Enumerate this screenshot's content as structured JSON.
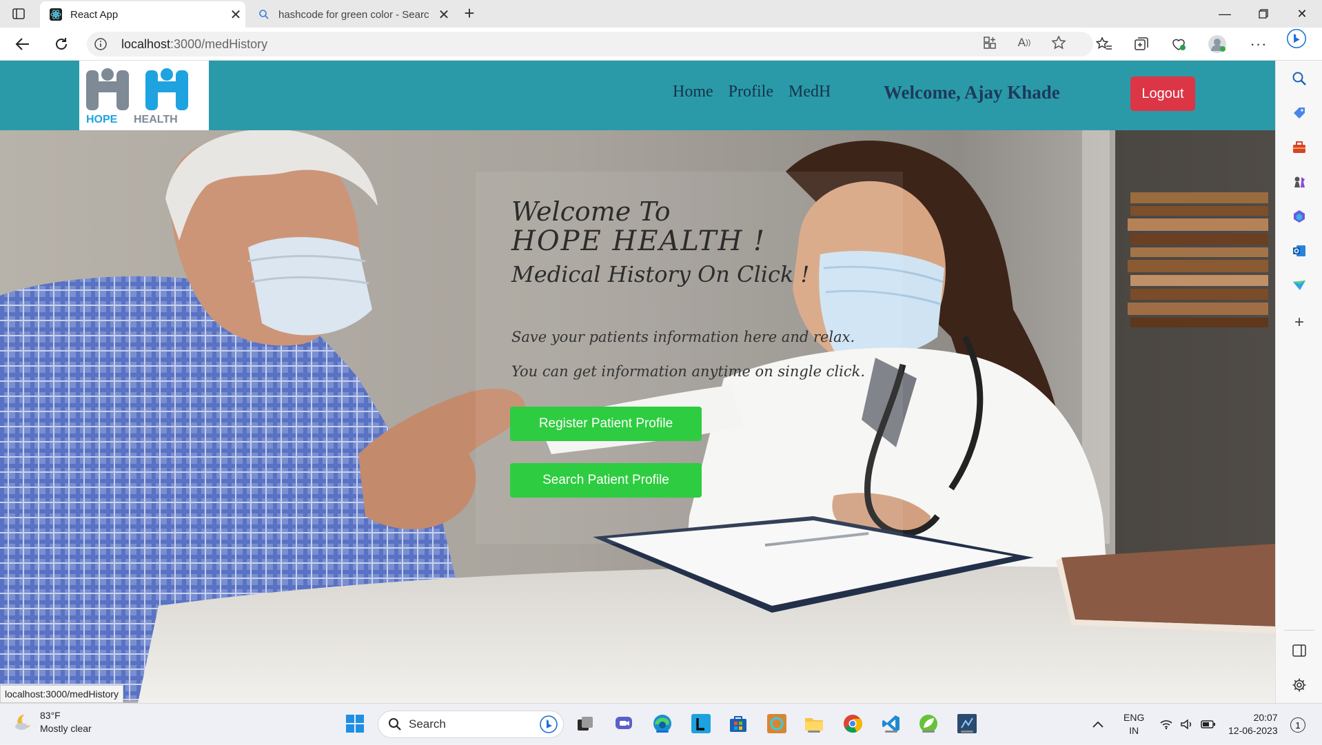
{
  "browser": {
    "tabs": [
      {
        "title": "React App",
        "active": true
      },
      {
        "title": "hashcode for green color - Searc",
        "active": false
      }
    ],
    "url_host": "localhost",
    "url_path": ":3000/medHistory",
    "status_url": "localhost:3000/medHistory"
  },
  "site": {
    "logo_text_a": "HOPE",
    "logo_text_b": "HEALTH",
    "nav": [
      "Home",
      "Profile",
      "MedH"
    ],
    "welcome": "Welcome, Ajay Khade",
    "logout_label": "Logout",
    "colors": {
      "header": "#2a9aa8",
      "logout": "#dc3545",
      "cta": "#2ecc40",
      "logo_blue": "#1ea3e0",
      "logo_grey": "#7e8a96"
    }
  },
  "hero": {
    "line1": "Welcome To",
    "line2": "HOPE HEALTH !",
    "line3": "Medical History On Click !",
    "line4": "Save your patients information here and relax.",
    "line5": "You can get information anytime on single click.",
    "button_register": "Register Patient Profile",
    "button_search": "Search Patient Profile"
  },
  "taskbar": {
    "weather_temp": "83°F",
    "weather_desc": "Mostly clear",
    "search_label": "Search",
    "lang_top": "ENG",
    "lang_bottom": "IN",
    "time": "20:07",
    "date": "12-06-2023",
    "notification_count": "1"
  }
}
